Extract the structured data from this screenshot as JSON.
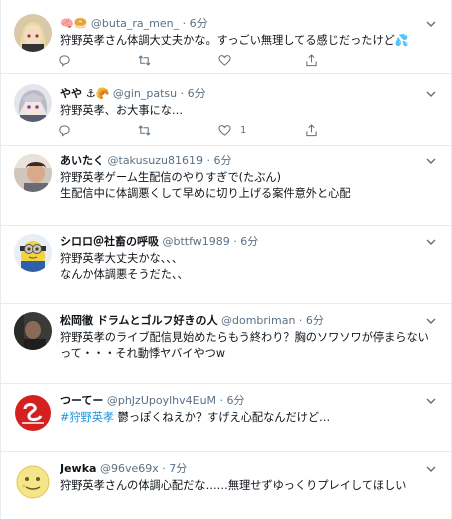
{
  "tweets": [
    {
      "name": "🧠🥯",
      "handle": "@buta_ra_men_",
      "sep": " · ",
      "time": "6分",
      "lines": [
        "狩野英孝さん体調大丈夫かな。すっごい無理してる感じだったけど💦"
      ],
      "like_count": "",
      "avatar": "anime-blonde"
    },
    {
      "name": "やや ⚓🥐",
      "handle": "@gin_patsu",
      "sep": " · ",
      "time": "6分",
      "lines": [
        "狩野英孝、お大事にな…"
      ],
      "like_count": "1",
      "avatar": "anime-gray"
    },
    {
      "name": "あいたく",
      "handle": "@takusuzu81619",
      "sep": " · ",
      "time": "6分",
      "lines": [
        "狩野英孝ゲーム生配信のやりすぎで(たぶん)",
        "生配信中に体調悪くして早めに切り上げる案件意外と心配"
      ],
      "like_count": "",
      "avatar": "photo-man"
    },
    {
      "name": "シロロ＠社畜の呼吸",
      "handle": "@bttfw1989",
      "sep": " · ",
      "time": "6分",
      "lines": [
        "狩野英孝大丈夫かな、、、",
        "なんか体調悪そうだた、、"
      ],
      "like_count": "",
      "avatar": "minion"
    },
    {
      "name": "松岡徹 ドラムとゴルフ好きの人",
      "handle": "@dombriman",
      "sep": " · ",
      "time": "6分",
      "lines": [
        "狩野英孝のライブ配信見始めたらもう終わり？胸のソワソワが停まらない",
        "って・・・それ動悸ヤバイやつw"
      ],
      "like_count": "",
      "avatar": "photo-dark"
    },
    {
      "name": "つーてー",
      "handle": "@phJzUpoylhv4EuM",
      "sep": " · ",
      "time": "6分",
      "hashtag": "#狩野英孝",
      "lines": [
        " 鬱っぽくねえか？すげえ心配なんだけど…"
      ],
      "like_count": "",
      "avatar": "logo-red"
    },
    {
      "name": "Jewka",
      "handle": "@96ve69x",
      "sep": " · ",
      "time": "7分",
      "lines": [
        "狩野英孝さんの体調心配だな……無理せずゆっくりプレイしてほしい"
      ],
      "like_count": "",
      "avatar": "moon-face"
    }
  ]
}
